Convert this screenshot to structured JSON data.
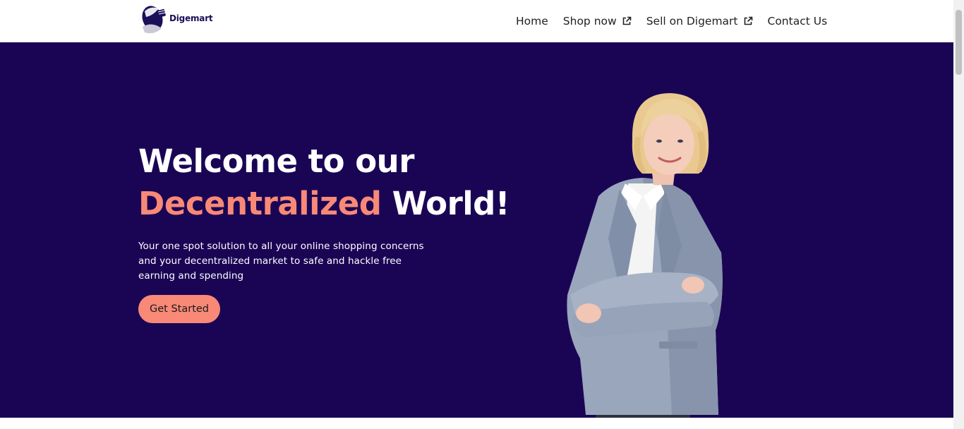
{
  "header": {
    "brand": "Digemart",
    "nav": [
      {
        "label": "Home",
        "icon": null
      },
      {
        "label": "Shop now",
        "icon": "external-link-icon"
      },
      {
        "label": "Sell on Digemart",
        "icon": "external-link-icon"
      },
      {
        "label": "Contact Us",
        "icon": null
      }
    ]
  },
  "hero": {
    "title_line1": "Welcome to our",
    "title_accent": "Decentralized",
    "title_rest": " World!",
    "description": "Your one spot solution to all your online shopping concerns and your decentralized market to safe and hackle free earning and spending",
    "cta_label": "Get Started"
  },
  "colors": {
    "hero_bg": "#1a0555",
    "accent": "#f88977",
    "brand_dark": "#1b0f59"
  }
}
